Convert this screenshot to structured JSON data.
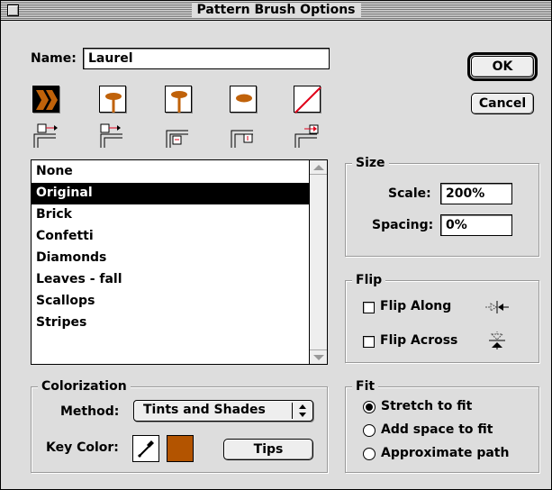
{
  "window": {
    "title": "Pattern Brush Options"
  },
  "name_field": {
    "label": "Name:",
    "value": "Laurel"
  },
  "buttons": {
    "ok": "OK",
    "cancel": "Cancel",
    "tips": "Tips"
  },
  "tiles": [
    {
      "name": "side-tile",
      "icon": "chevron-pattern-icon"
    },
    {
      "name": "outer-corner-tile",
      "icon": "leaf-stem-icon"
    },
    {
      "name": "inner-corner-tile",
      "icon": "leaf-stem-icon"
    },
    {
      "name": "start-tile",
      "icon": "leaf-icon"
    },
    {
      "name": "end-tile",
      "icon": "none-slash-icon"
    }
  ],
  "pattern_list": {
    "items": [
      "None",
      "Original",
      "Brick",
      "Confetti",
      "Diamonds",
      "Leaves - fall",
      "Scallops",
      "Stripes"
    ],
    "selected_index": 1
  },
  "size": {
    "title": "Size",
    "scale_label": "Scale:",
    "scale_value": "200%",
    "spacing_label": "Spacing:",
    "spacing_value": "0%"
  },
  "flip": {
    "title": "Flip",
    "along_label": "Flip Along",
    "along_checked": false,
    "across_label": "Flip Across",
    "across_checked": false
  },
  "fit": {
    "title": "Fit",
    "options": [
      "Stretch to fit",
      "Add space to fit",
      "Approximate path"
    ],
    "selected_index": 0
  },
  "colorization": {
    "title": "Colorization",
    "method_label": "Method:",
    "method_value": "Tints and Shades",
    "key_color_label": "Key Color:",
    "key_color": "#b35400"
  },
  "colors": {
    "leaf": "#c0620a",
    "accent_red": "#e0001a"
  }
}
